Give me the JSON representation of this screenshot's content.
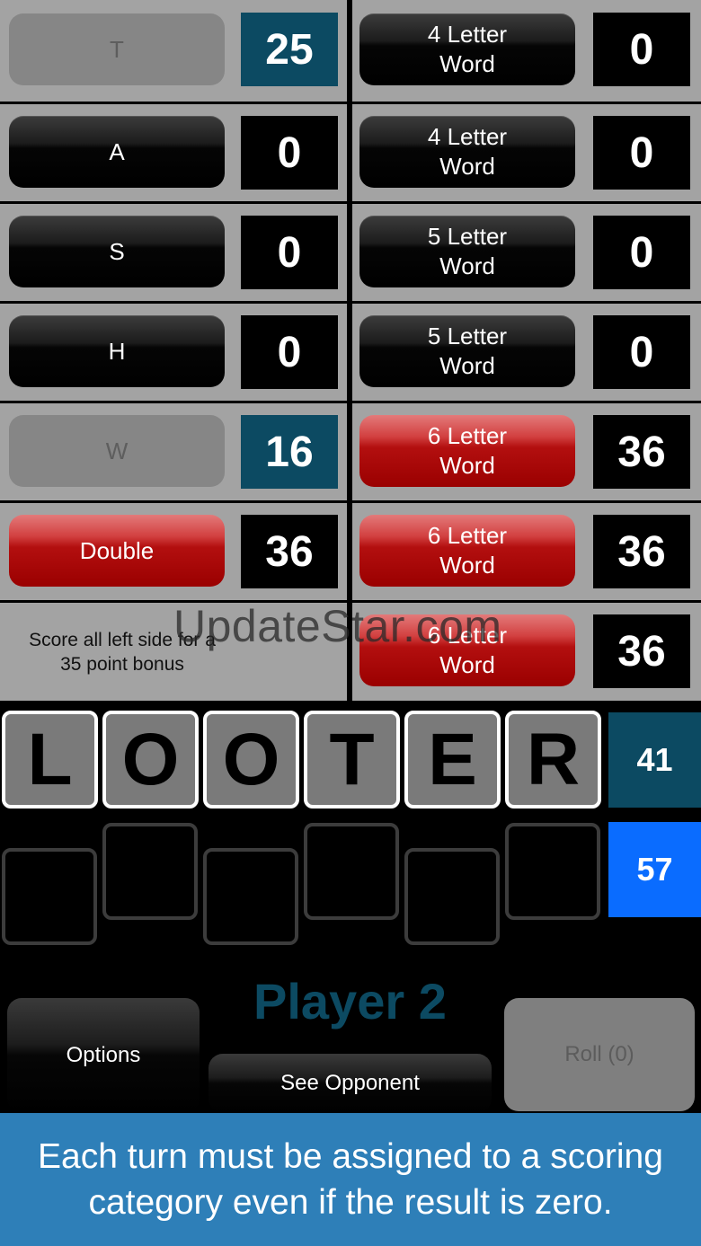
{
  "left_column": [
    {
      "label": "T",
      "score": "25",
      "state": "used"
    },
    {
      "label": "A",
      "score": "0",
      "state": "open"
    },
    {
      "label": "S",
      "score": "0",
      "state": "open"
    },
    {
      "label": "H",
      "score": "0",
      "state": "open"
    },
    {
      "label": "W",
      "score": "16",
      "state": "used"
    },
    {
      "label": "Double",
      "score": "36",
      "state": "active"
    }
  ],
  "bonus_text": "Score all left side for a 35 point bonus",
  "right_column": [
    {
      "label": "4 Letter Word",
      "score": "0",
      "state": "open"
    },
    {
      "label": "4 Letter Word",
      "score": "0",
      "state": "open"
    },
    {
      "label": "5 Letter Word",
      "score": "0",
      "state": "open"
    },
    {
      "label": "5 Letter Word",
      "score": "0",
      "state": "open"
    },
    {
      "label": "6 Letter Word",
      "score": "36",
      "state": "active"
    },
    {
      "label": "6 Letter Word",
      "score": "36",
      "state": "active"
    },
    {
      "label": "6 Letter Word",
      "score": "36",
      "state": "active"
    }
  ],
  "watermark": "UpdateStar.com",
  "tiles": [
    "L",
    "O",
    "O",
    "T",
    "E",
    "R"
  ],
  "totals": {
    "turn": "41",
    "total": "57"
  },
  "player_label": "Player 2",
  "buttons": {
    "options": "Options",
    "see_opponent": "See Opponent",
    "roll": "Roll (0)"
  },
  "banner": "Each turn must be assigned to a scoring category even if the result is zero.",
  "colors": {
    "score_filled": "#0c4a62",
    "total_highlight": "#0a6cff",
    "banner": "#2e7fb8"
  }
}
